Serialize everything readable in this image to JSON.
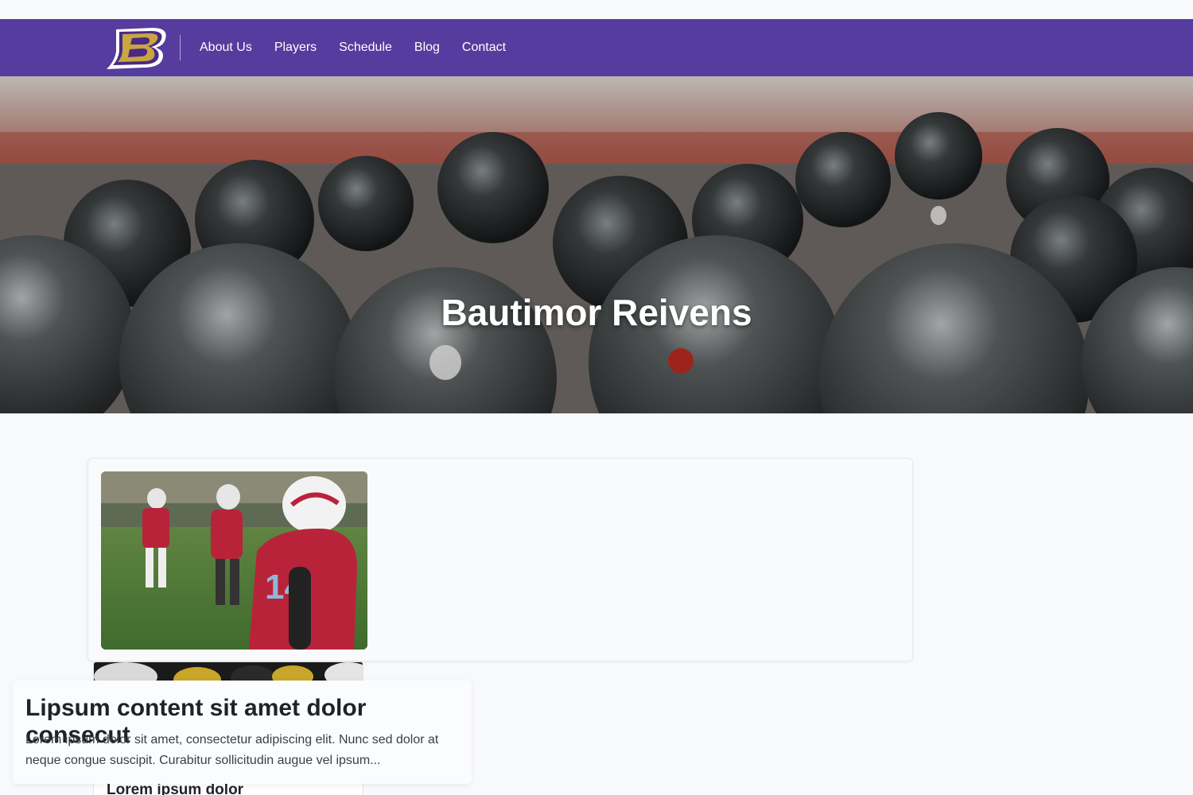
{
  "brand": {
    "logo_letter": "B",
    "colors": {
      "nav_bg": "#553c9e",
      "logo_gold": "#c9a640",
      "logo_purple": "#4a2a86"
    }
  },
  "nav": {
    "items": [
      {
        "label": "About Us"
      },
      {
        "label": "Players"
      },
      {
        "label": "Schedule"
      },
      {
        "label": "Blog"
      },
      {
        "label": "Contact"
      }
    ]
  },
  "hero": {
    "title": "Bautimor Reivens"
  },
  "posts": {
    "featured_image_alt": "football player number 14 in red jersey",
    "second_card_title": "Lorem ipsum dolor",
    "overlay": {
      "title": "Lipsum content sit amet dolor consecut",
      "excerpt": "Lorem ipsum dolor sit amet, consectetur adipiscing elit. Nunc sed dolor at neque congue suscipit. Curabitur sollicitudin augue vel ipsum..."
    }
  }
}
